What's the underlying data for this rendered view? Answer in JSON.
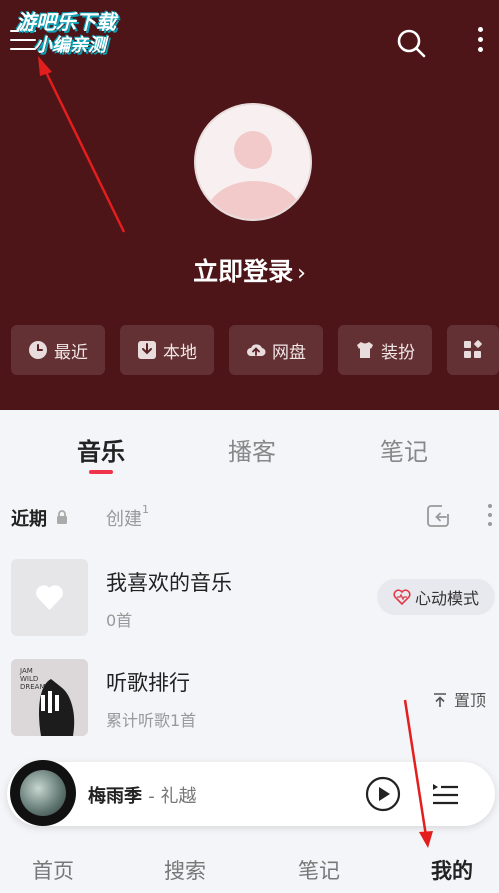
{
  "watermark": {
    "line1": "游吧乐下载",
    "line2": "小编亲测"
  },
  "profile": {
    "login_label": "立即登录",
    "chevron": "›"
  },
  "quick_actions": [
    {
      "label": "最近",
      "icon": "clock-icon"
    },
    {
      "label": "本地",
      "icon": "download-box-icon"
    },
    {
      "label": "网盘",
      "icon": "cloud-upload-icon"
    },
    {
      "label": "装扮",
      "icon": "shirt-icon"
    },
    {
      "label": "",
      "icon": "apps-grid-icon"
    }
  ],
  "tabs": [
    {
      "label": "音乐",
      "active": true
    },
    {
      "label": "播客",
      "active": false
    },
    {
      "label": "笔记",
      "active": false
    }
  ],
  "subbar": {
    "recent_label": "近期",
    "create_label": "创建",
    "create_count": "1"
  },
  "playlists": [
    {
      "title": "我喜欢的音乐",
      "subtitle": "0首",
      "action": "心动模式",
      "cover": "heart-icon"
    },
    {
      "title": "听歌排行",
      "subtitle": "累计听歌1首",
      "action": "置顶",
      "cover": "album-cover"
    }
  ],
  "player": {
    "song": "梅雨季",
    "artist": "- 礼越"
  },
  "bottom_nav": [
    {
      "label": "首页",
      "active": false
    },
    {
      "label": "搜索",
      "active": false
    },
    {
      "label": "笔记",
      "active": false
    },
    {
      "label": "我的",
      "active": true
    }
  ],
  "colors": {
    "header_bg": "#4e1519",
    "accent": "#f0324b",
    "page_bg": "#f4f5f8"
  }
}
